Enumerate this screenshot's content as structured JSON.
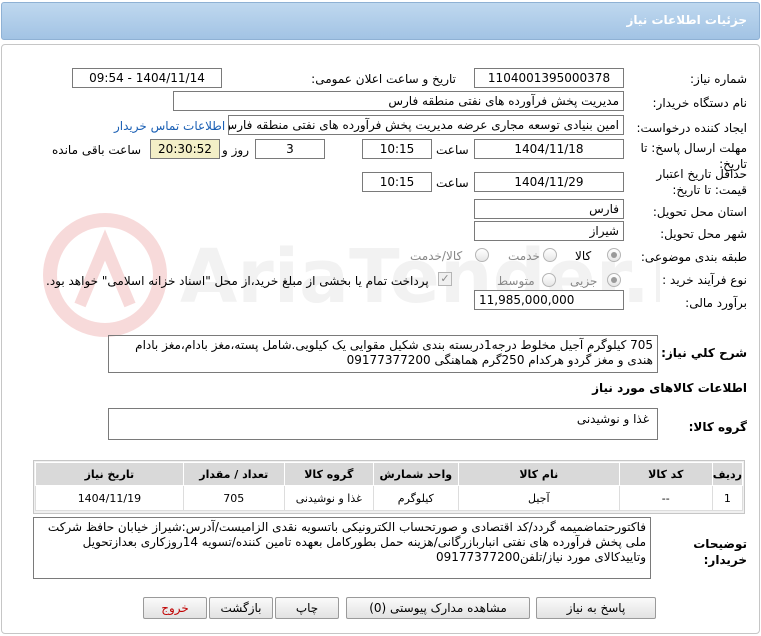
{
  "header": {
    "title": "جزئیات اطلاعات نیاز"
  },
  "fields": {
    "need_number": {
      "label": "شماره نیاز:",
      "value": "1104001395000378"
    },
    "announce_datetime": {
      "label": "تاریخ و ساعت اعلان عمومی:",
      "value": "1404/11/14 - 09:54"
    },
    "buyer_org": {
      "label": "نام دستگاه خریدار:",
      "value": "مدیریت پخش فرآورده های نفتی منطقه فارس"
    },
    "requester": {
      "label": "ایجاد کننده درخواست:",
      "value": "امین بنیادی توسعه مجاری عرضه مدیریت پخش فرآورده های نفتی منطقه فارس",
      "contact_link": "اطلاعات تماس خریدار"
    },
    "reply_deadline": {
      "label": "مهلت ارسال پاسخ: تا تاریخ:",
      "date": "1404/11/18",
      "time_label": "ساعت",
      "time": "10:15",
      "days": "3",
      "days_label": "روز و",
      "remaining": "20:30:52",
      "remaining_label": "ساعت باقی مانده"
    },
    "price_validity": {
      "label": "حداقل تاریخ اعتبار قیمت: تا تاریخ:",
      "date": "1404/11/29",
      "time_label": "ساعت",
      "time": "10:15"
    },
    "province": {
      "label": "استان محل تحویل:",
      "value": "فارس"
    },
    "city": {
      "label": "شهر محل تحویل:",
      "value": "شیراز"
    },
    "category": {
      "label": "طبقه بندی موضوعی:",
      "options": [
        "کالا",
        "خدمت",
        "کالا/خدمت"
      ]
    },
    "purchase_type": {
      "label": "نوع فرآیند خرید :",
      "options": [
        "جزیی",
        "متوسط"
      ],
      "treasury_note": "پرداخت تمام یا بخشی از مبلغ خرید،از محل \"اسناد خزانه اسلامی\" خواهد بود."
    },
    "estimate": {
      "label": "برآورد مالی:",
      "value": "11,985,000,000"
    }
  },
  "description": {
    "label": "شرح کلي نياز:",
    "text": "705 کیلوگرم آجیل مخلوط درجه1دربسته بندی شکیل مقوایی یک کیلویی.شامل پسته،مغز بادام،مغز بادام هندی و مغز گردو هرکدام 250گرم هماهنگی 09177377200"
  },
  "goods_section": {
    "title": "اطلاعات کالاهای مورد نیاز",
    "group_label": "گروه کالا:",
    "group_value": "غذا و نوشیدنی"
  },
  "table": {
    "headers": [
      "ردیف",
      "کد کالا",
      "نام کالا",
      "واحد شمارش",
      "گروه کالا",
      "تعداد / مقدار",
      "تاریخ نیاز"
    ],
    "rows": [
      [
        "1",
        "--",
        "آجیل",
        "کیلوگرم",
        "غذا و نوشیدنی",
        "705",
        "1404/11/19"
      ]
    ]
  },
  "buyer_notes": {
    "label": "توضیحات خریدار:",
    "text": "فاکتورحتماضمیمه گردد/کد اقتصادی و صورتحساب الکترونیکی باتسویه نقدی الزامیست/آدرس:شیراز خیابان حافظ شرکت ملی پخش فرآورده های نفتی انباربازرگانی/هزینه حمل بطورکامل بعهده تامین کننده/تسویه 14روزکاری بعدازتحویل وتاییدکالای مورد نیاز/تلفن09177377200"
  },
  "buttons": {
    "reply": "پاسخ به نیاز",
    "view_docs": "مشاهده مدارک پیوستی (0)",
    "print": "چاپ",
    "back": "بازگشت",
    "exit": "خروج"
  },
  "watermark": {
    "text": "AriaTender.neT"
  },
  "colors": {
    "title_bar": "#a2c3e4",
    "link": "#1a5fb4",
    "exit_button_text": "#c00000",
    "table_header": "#d9d9d9"
  }
}
